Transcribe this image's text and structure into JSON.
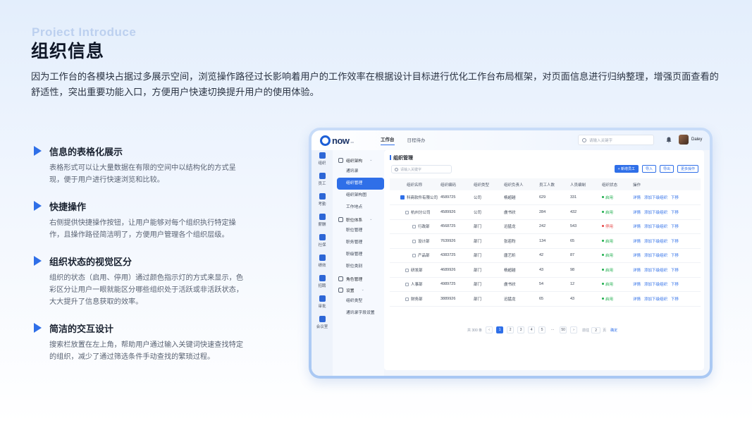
{
  "header": {
    "en_title": "Project Introduce",
    "title": "组织信息",
    "intro": "因为工作台的各模块占据过多展示空间，浏览操作路径过长影响着用户的工作效率在根据设计目标进行优化工作台布局框架，对页面信息进行归纳整理，增强页面查看的舒适性，突出重要功能入口，方便用户快速切换提升用户的使用体验。"
  },
  "features": [
    {
      "title": "信息的表格化展示",
      "desc": "表格形式可以让大量数据在有限的空间中以结构化的方式呈现，便于用户进行快速浏览和比较。"
    },
    {
      "title": "快捷操作",
      "desc": "右侧提供快捷操作按钮，让用户能够对每个组织执行特定操作，且操作路径简洁明了，方便用户管理各个组织层级。"
    },
    {
      "title": "组织状态的视觉区分",
      "desc": "组织的状态（启用、停用）通过颜色指示灯的方式来显示，色彩区分让用户一眼就能区分哪些组织处于活跃或非活跃状态，大大提升了信息获取的效率。"
    },
    {
      "title": "简洁的交互设计",
      "desc": "搜索栏放置在左上角，帮助用户通过输入关键词快速查找特定的组织，减少了通过筛选条件手动查找的繁琐过程。"
    }
  ],
  "app": {
    "logo": "now",
    "logo_sub": ".co",
    "tabs": [
      "工作台",
      "日程待办"
    ],
    "search_placeholder": "请输入关键字",
    "user": "Daley",
    "rail": [
      "组织",
      "员工",
      "考勤",
      "薪酬",
      "社保",
      "绩效",
      "招聘",
      "审批",
      "会议室"
    ],
    "nav": {
      "org_group": "组织架构",
      "org_items": [
        "通讯录",
        "组织管理",
        "组织架构图",
        "工作地点"
      ],
      "pos_group": "职位体系",
      "pos_items": [
        "职位管理",
        "职务管理",
        "职级管理",
        "职位类别"
      ],
      "role_group": "角色管理",
      "set_group": "设置",
      "set_items": [
        "组织类型",
        "通讯录字段设置"
      ]
    },
    "content_title": "组织管理",
    "org_search_placeholder": "请输入关键字",
    "buttons": {
      "add": "+ 新增员工",
      "import": "导入",
      "export": "导出",
      "more": "更多操作"
    },
    "columns": [
      "组织名称",
      "组织编码",
      "组织类型",
      "组织负责人",
      "员工人数",
      "人员编制",
      "组织状态",
      "操作"
    ],
    "actions": [
      "详情",
      "添加下级组织",
      "下移"
    ],
    "rows": [
      {
        "name": "科商软件有限公司",
        "code": "4589725",
        "type": "公司",
        "head": "杨超越",
        "staff": "629",
        "quota": "331",
        "status": "启用",
        "level": 0
      },
      {
        "name": "杭州分公司",
        "code": "4589926",
        "type": "公司",
        "head": "虞书欣",
        "staff": "284",
        "quota": "432",
        "status": "启用",
        "level": 1
      },
      {
        "name": "行政部",
        "code": "4568725",
        "type": "部门",
        "head": "迅猛龙",
        "staff": "242",
        "quota": "543",
        "status": "停用",
        "level": 2
      },
      {
        "name": "设计部",
        "code": "7639926",
        "type": "部门",
        "head": "张若昀",
        "staff": "134",
        "quota": "65",
        "status": "启用",
        "level": 2
      },
      {
        "name": "产品部",
        "code": "4383725",
        "type": "部门",
        "head": "唐艺昕",
        "staff": "42",
        "quota": "87",
        "status": "启用",
        "level": 2
      },
      {
        "name": "研发部",
        "code": "4689926",
        "type": "部门",
        "head": "杨超越",
        "staff": "43",
        "quota": "98",
        "status": "启用",
        "level": 1
      },
      {
        "name": "人事部",
        "code": "4989725",
        "type": "部门",
        "head": "虞书欣",
        "staff": "54",
        "quota": "12",
        "status": "启用",
        "level": 1
      },
      {
        "name": "财务部",
        "code": "3889926",
        "type": "部门",
        "head": "迅猛龙",
        "staff": "65",
        "quota": "43",
        "status": "启用",
        "level": 1
      }
    ],
    "pager": {
      "total": "共 300 条",
      "pages": [
        "1",
        "2",
        "3",
        "4",
        "5",
        "...",
        "50"
      ],
      "goto": "前往",
      "page_input": "2",
      "page_unit": "页",
      "confirm": "确定"
    }
  }
}
